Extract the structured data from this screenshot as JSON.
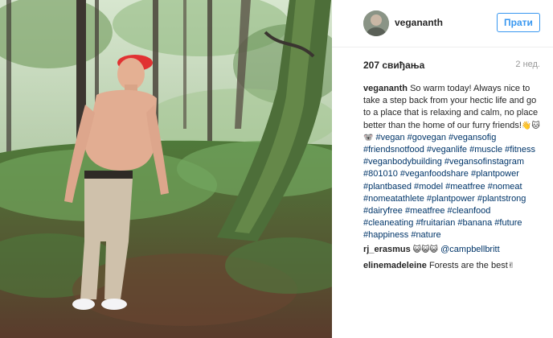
{
  "post": {
    "username": "vegananth",
    "follow_label": "Прати",
    "likes": "207 свиђања",
    "time_ago": "2 нед.",
    "caption_author": "vegananth",
    "caption_text": "So warm today! Always nice to take a step back from your hectic life and go to a place that is relaxing and calm, no place better than the home of our furry friends!",
    "caption_emojis": "👋🐱🐨",
    "hashtags": "#vegan #govegan #vegansofig #friendsnotfood #veganlife #muscle #fitness #veganbodybuilding #vegansofinstagram #801010 #veganfoodshare #plantpower #plantbased #model #meatfree #nomeat #nomeatathlete #plantpower #plantstrong #dairyfree #meatfree #cleanfood #cleaneating #fruitarian #banana #future #happiness #nature"
  },
  "comments": [
    {
      "user": "rj_erasmus",
      "emojis": "😺😺😺",
      "text": "",
      "mention": "@campbellbritt"
    },
    {
      "user": "elinemadeleine",
      "text": "Forests are the best",
      "emojis": "✌",
      "mention": ""
    }
  ],
  "colors": {
    "accent": "#3897f0",
    "hashtag": "#003569",
    "muted": "#999999"
  },
  "icons": {
    "avatar": "profile-avatar"
  }
}
